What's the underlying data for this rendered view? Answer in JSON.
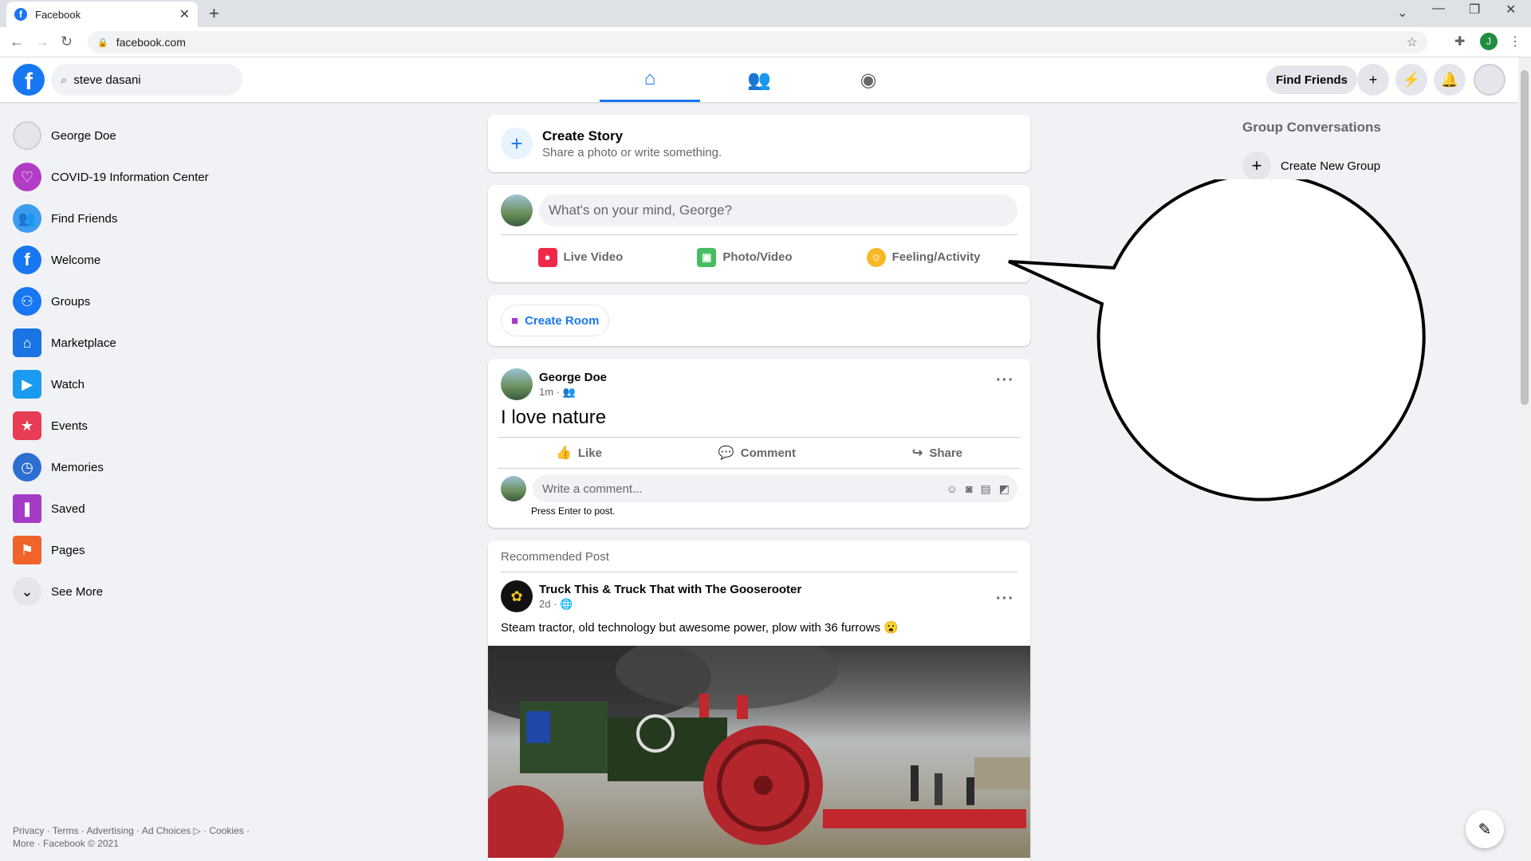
{
  "browser": {
    "tab_title": "Facebook",
    "url": "facebook.com",
    "profile_initial": "J"
  },
  "topnav": {
    "search_value": "steve dasani",
    "find_friends": "Find Friends"
  },
  "sidebar": {
    "items": [
      {
        "label": "George Doe",
        "icon": "profile-avatar-icon"
      },
      {
        "label": "COVID-19 Information Center",
        "icon": "heart-icon"
      },
      {
        "label": "Find Friends",
        "icon": "friends-icon"
      },
      {
        "label": "Welcome",
        "icon": "facebook-icon"
      },
      {
        "label": "Groups",
        "icon": "groups-icon"
      },
      {
        "label": "Marketplace",
        "icon": "store-icon"
      },
      {
        "label": "Watch",
        "icon": "video-icon"
      },
      {
        "label": "Events",
        "icon": "calendar-icon"
      },
      {
        "label": "Memories",
        "icon": "clock-icon"
      },
      {
        "label": "Saved",
        "icon": "bookmark-icon"
      },
      {
        "label": "Pages",
        "icon": "flag-icon"
      },
      {
        "label": "See More",
        "icon": "chevron-down-icon"
      }
    ],
    "footer_line1": "Privacy · Terms · Advertising · Ad Choices ▷ · Cookies ·",
    "footer_line2": "More · Facebook © 2021"
  },
  "story": {
    "title": "Create Story",
    "subtitle": "Share a photo or write something."
  },
  "composer": {
    "placeholder": "What's on your mind, George?",
    "actions": [
      "Live Video",
      "Photo/Video",
      "Feeling/Activity"
    ]
  },
  "room": {
    "label": "Create Room"
  },
  "post": {
    "author": "George Doe",
    "meta": "1m ·",
    "text": "I love nature",
    "like": "Like",
    "comment": "Comment",
    "share": "Share",
    "comment_placeholder": "Write a comment...",
    "press_enter": "Press Enter to post."
  },
  "recommended": {
    "header": "Recommended Post",
    "author": "Truck This & Truck That with The Gooserooter",
    "meta": "2d ·",
    "text": "Steam tractor, old technology but awesome power, plow with 36 furrows 😮"
  },
  "right": {
    "heading": "Group Conversations",
    "create_group": "Create New Group"
  },
  "colors": {
    "brand": "#1877f2",
    "background": "#f0f2f5"
  }
}
